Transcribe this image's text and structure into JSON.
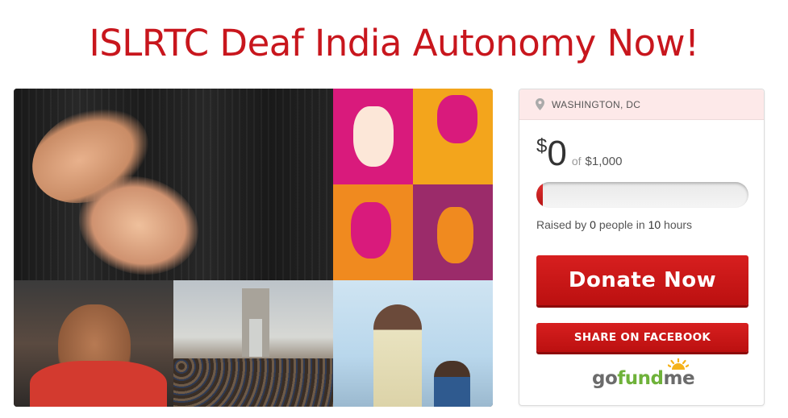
{
  "page": {
    "title": "ISLRTC Deaf India Autonomy Now!"
  },
  "campaign": {
    "location": "WASHINGTON, DC",
    "currency_symbol": "$",
    "raised_amount": "0",
    "of_label": "of",
    "goal_amount": "$1,000",
    "progress_fraction": 0.03,
    "stats": {
      "prefix": "Raised by",
      "people_count": "0",
      "people_label": "people in",
      "hours_count": "10",
      "hours_label": "hours"
    },
    "donate_label": "Donate Now",
    "share_label": "SHARE ON FACEBOOK"
  },
  "logo": {
    "part1": "go",
    "part2": "fund",
    "part3": "me"
  },
  "colors": {
    "brand_red": "#c8161d",
    "button_red": "#c81818",
    "logo_green": "#6fb23a",
    "location_bg": "#fde9e9"
  },
  "icons": {
    "location": "map-pin-icon",
    "logo_sun": "sun-icon"
  }
}
